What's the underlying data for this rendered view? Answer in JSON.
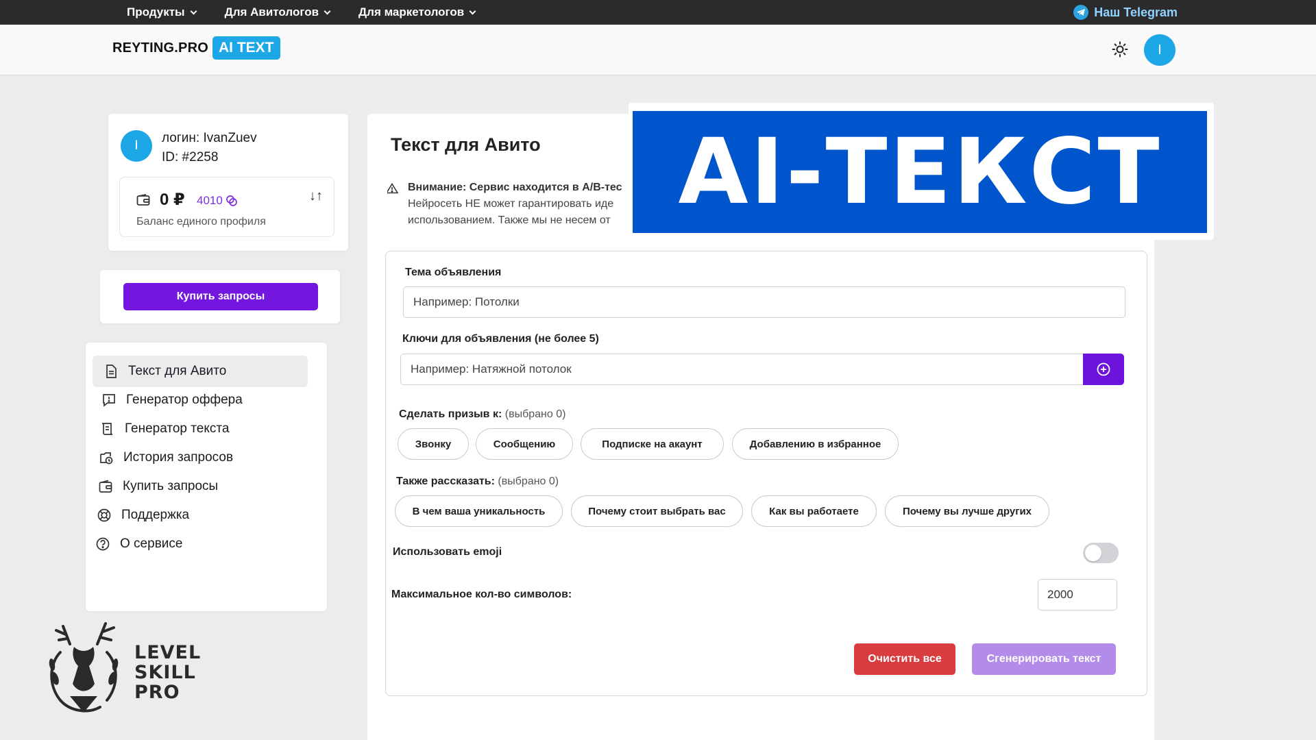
{
  "topnav": {
    "items": [
      "Продукты",
      "Для Авитологов",
      "Для маркетологов"
    ],
    "telegram": "Наш Telegram"
  },
  "header": {
    "brand": "REYTING.PRO",
    "badge": "AI TEXT",
    "avatar_letter": "I"
  },
  "profile": {
    "avatar_letter": "I",
    "login": "логин: IvanZuev",
    "id": "ID: #2258",
    "balance_rub": "0 ₽",
    "coins": "4010",
    "balance_label": "Баланс единого профиля"
  },
  "buy_button": "Купить запросы",
  "menu": [
    {
      "label": "Текст для Авито",
      "icon": "document-icon",
      "active": true
    },
    {
      "label": "Генератор оффера",
      "icon": "message-icon"
    },
    {
      "label": "Генератор текста",
      "icon": "scroll-icon"
    },
    {
      "label": "История запросов",
      "icon": "history-icon"
    },
    {
      "label": "Купить запросы",
      "icon": "wallet-icon"
    },
    {
      "label": "Поддержка",
      "icon": "lifebuoy-icon"
    },
    {
      "label": "О сервисе",
      "icon": "help-icon"
    }
  ],
  "main": {
    "title": "Текст для Авито",
    "warning_title": "Внимание: Сервис находится в A/B-тес",
    "warning_line2": "Нейросеть НЕ может гарантировать иде",
    "warning_line3": "использованием. Также мы не несем от"
  },
  "banner": "AI-ТЕКСТ",
  "form": {
    "topic_label": "Тема объявления",
    "topic_placeholder": "Например: Потолки",
    "keys_label": "Ключи для объявления (не более 5)",
    "keys_placeholder": "Например: Натяжной потолок",
    "cta_label": "Сделать призыв к:",
    "cta_count": "(выбрано 0)",
    "cta_options": [
      "Звонку",
      "Сообщению",
      "Подписке на акаунт",
      "Добавлению в избранное"
    ],
    "tell_label": "Также рассказать:",
    "tell_count": "(выбрано 0)",
    "tell_options": [
      "В чем ваша уникальность",
      "Почему стоит выбрать вас",
      "Как вы работаете",
      "Почему вы лучше других"
    ],
    "emoji_label": "Использовать emoji",
    "emoji_enabled": false,
    "max_label": "Максимальное кол-во символов:",
    "max_value": "2000",
    "clear_button": "Очистить все",
    "generate_button": "Сгенерировать текст"
  },
  "watermark": {
    "line1": "LEVEL",
    "line2": "SKILL",
    "line3": "PRO"
  },
  "colors": {
    "accent_blue": "#1ea7e6",
    "purple": "#7216e0",
    "banner_blue": "#0055cc",
    "danger": "#d83c3f"
  }
}
